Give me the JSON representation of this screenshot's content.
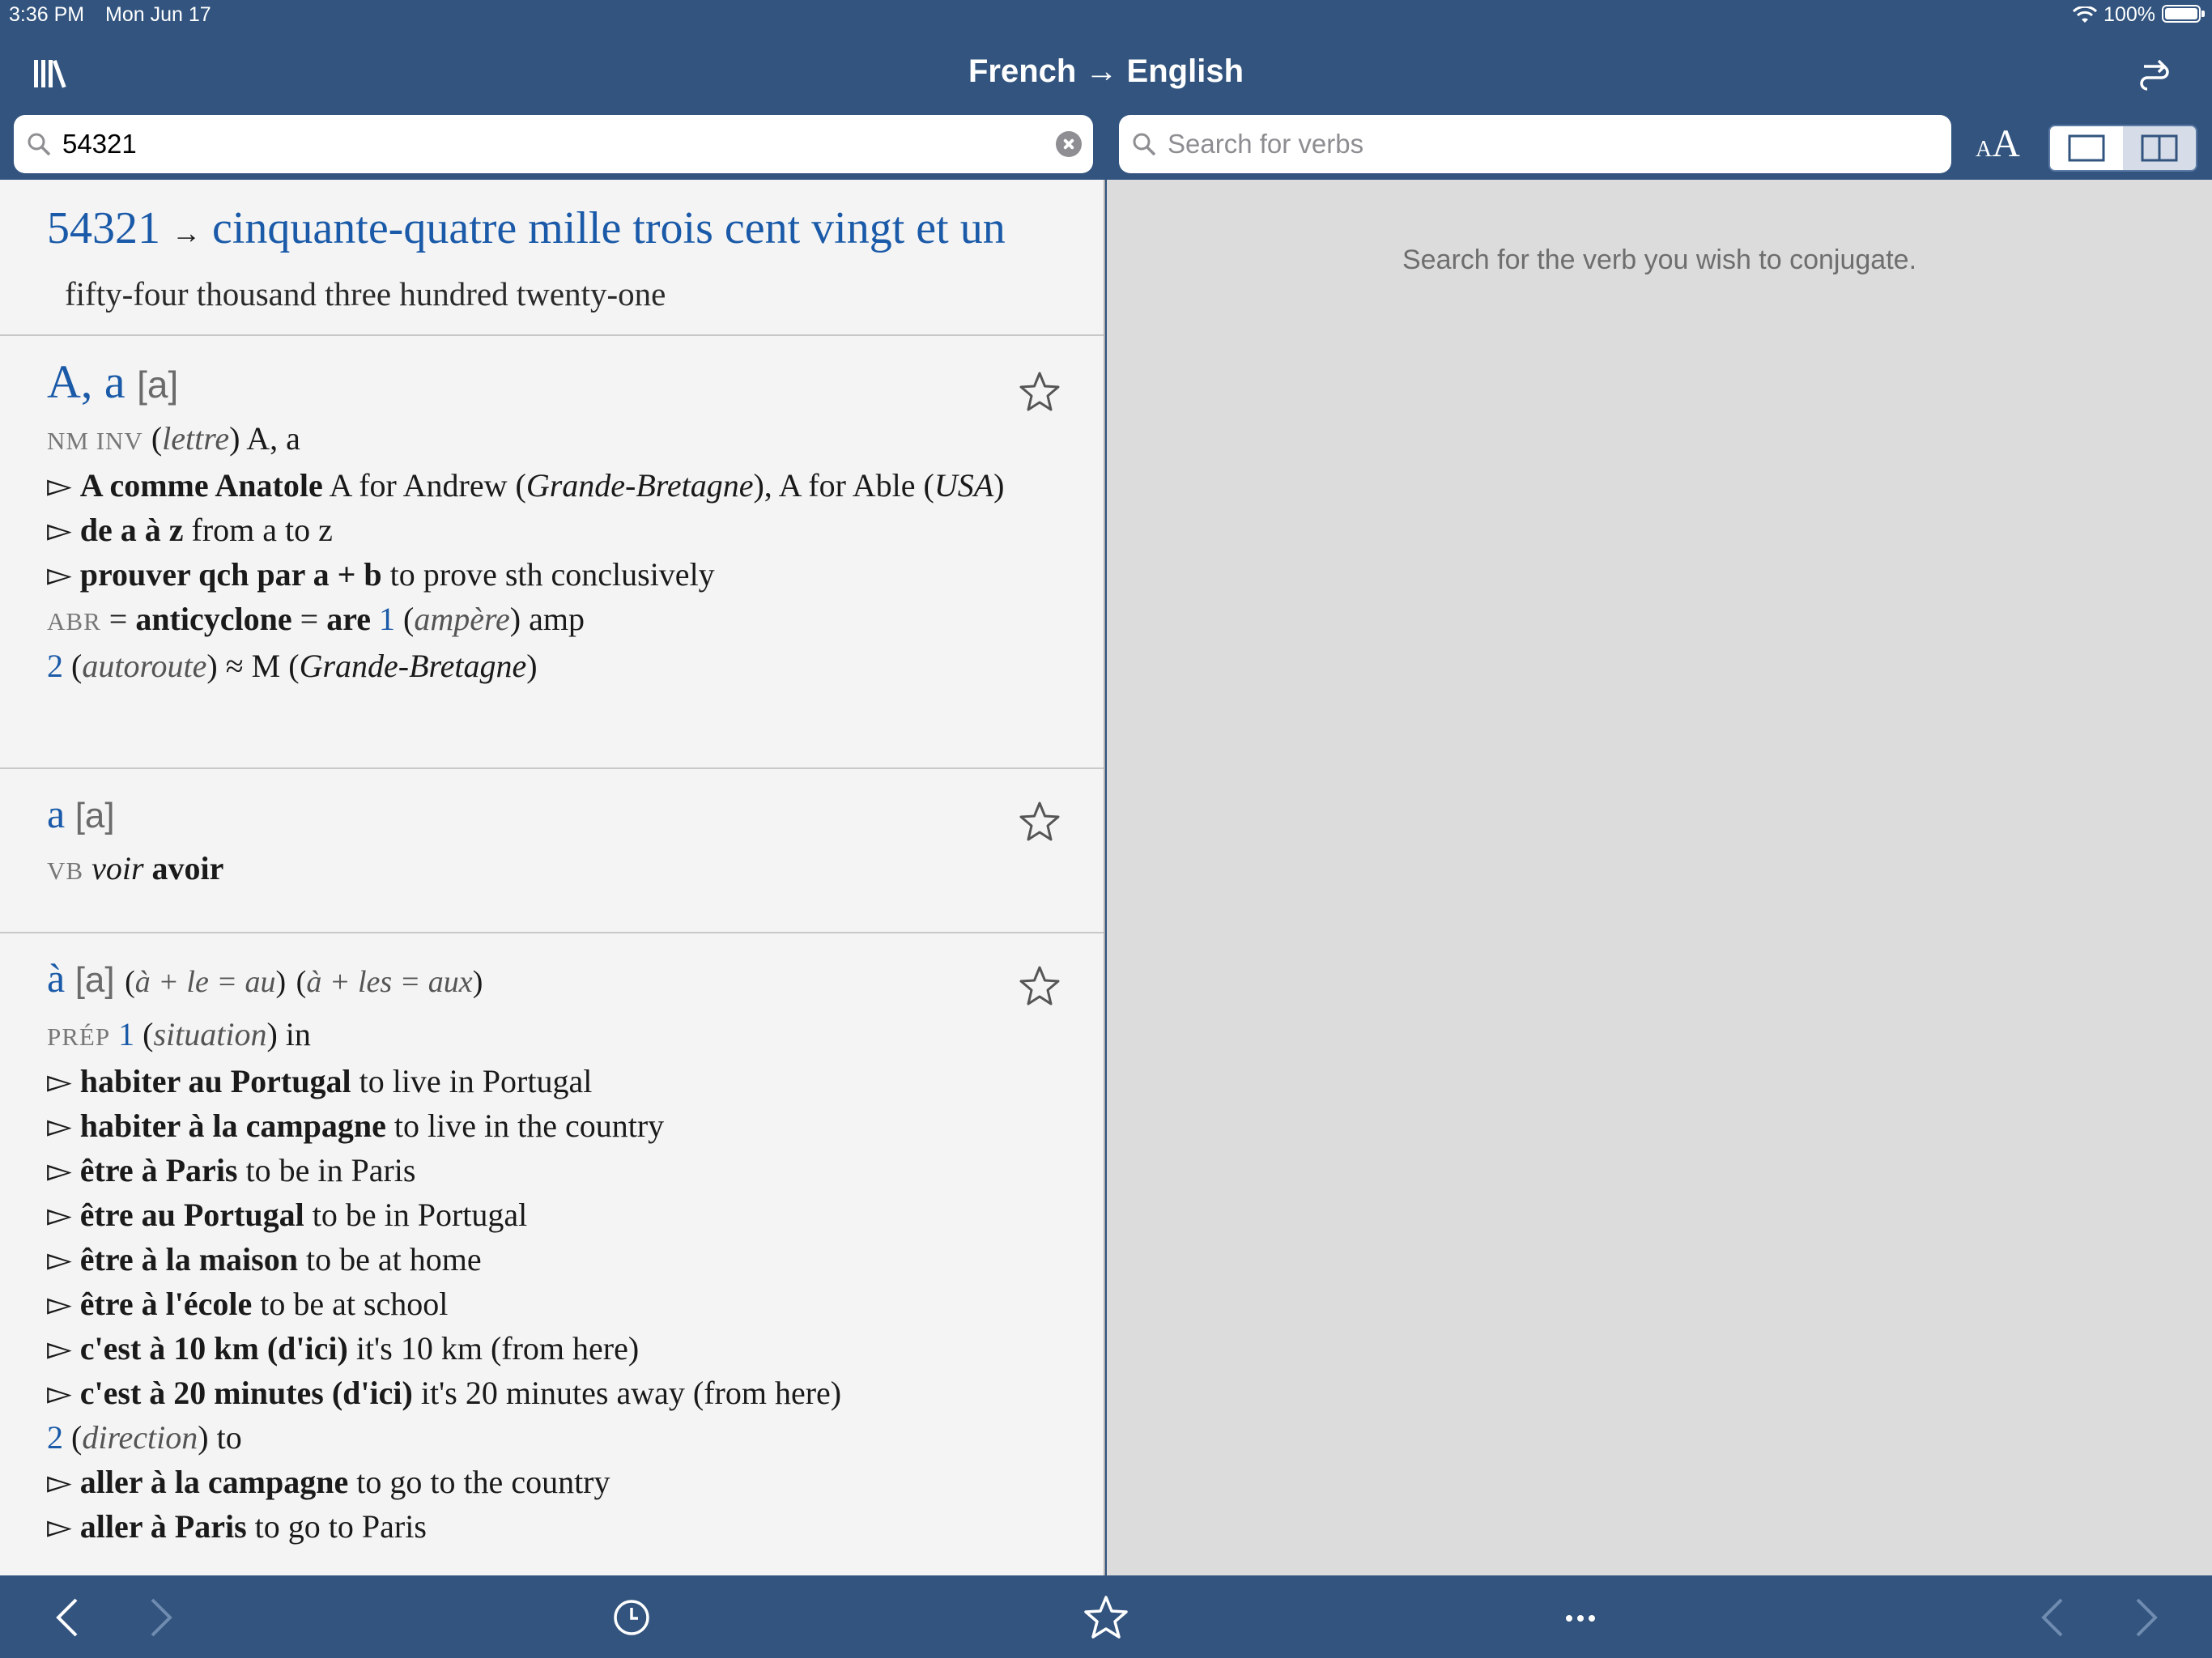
{
  "status": {
    "time": "3:36 PM",
    "date": "Mon Jun 17",
    "battery": "100%"
  },
  "nav": {
    "title": "French → English",
    "library_icon": "library-icon",
    "swap_icon": "swap-direction-icon"
  },
  "search": {
    "value": "54321",
    "verb_placeholder": "Search for verbs"
  },
  "font_size": {
    "small": "A",
    "big": "A"
  },
  "entries": {
    "number": {
      "headword": "54321",
      "arrow": "→",
      "french": "cinquante-quatre mille trois cent vingt et un",
      "translation": "fifty-four thousand three hundred twenty-one"
    },
    "A": {
      "headword": "A, a",
      "pron": "[a]",
      "line1_pos": "NM INV",
      "line1_gloss": "lettre",
      "line1_trans": "A, a",
      "ex1_fr": "A comme Anatole",
      "ex1_en_a": "A for Andrew",
      "ex1_it_a": "Grande-Bretagne",
      "ex1_en_b": "A for Able",
      "ex1_it_b": "USA",
      "ex2_fr": "de a à z",
      "ex2_en": "from a to z",
      "ex3_fr": "prouver qch par a + b",
      "ex3_en": "to prove sth conclusively",
      "abr_pos": "ABR",
      "abr_word1": "anticyclone",
      "abr_word2": "are",
      "abr_num": "1",
      "abr_gloss": "ampère",
      "abr_trans": "amp",
      "s2_num": "2",
      "s2_gloss": "autoroute",
      "s2_trans": "≈ M",
      "s2_it": "Grande-Bretagne"
    },
    "a": {
      "headword": "a",
      "pron": "[a]",
      "pos": "VB",
      "voir": "voir",
      "ref": "avoir"
    },
    "aa": {
      "headword": "à",
      "pron": "[a]",
      "contraction1": "à + le = au",
      "contraction2": "à + les = aux",
      "pos": "PRÉP",
      "s1_num": "1",
      "s1_gloss": "situation",
      "s1_trans": "in",
      "examples": [
        {
          "fr": "habiter au Portugal",
          "en": "to live in Portugal"
        },
        {
          "fr": "habiter à la campagne",
          "en": "to live in the country"
        },
        {
          "fr": "être à Paris",
          "en": "to be in Paris"
        },
        {
          "fr": "être au Portugal",
          "en": "to be in Portugal"
        },
        {
          "fr": "être à la maison",
          "en": "to be at home"
        },
        {
          "fr": "être à l'école",
          "en": "to be at school"
        },
        {
          "fr": "c'est à 10 km (d'ici)",
          "en": "it's 10 km (from here)"
        },
        {
          "fr": "c'est à 20 minutes (d'ici)",
          "en": "it's 20 minutes away (from here)"
        }
      ],
      "s2_num": "2",
      "s2_gloss": "direction",
      "s2_trans": "to",
      "ex_last_fr": "aller à la campagne",
      "ex_last_en": "to go to the country",
      "ex_cut_fr": "aller à Paris",
      "ex_cut_en": "to go to Paris"
    }
  },
  "right": {
    "hint": "Search for the verb you wish to conjugate."
  },
  "toolbar": {
    "back_icon": "chevron-left-icon",
    "forward_icon": "chevron-right-icon",
    "history_icon": "clock-icon",
    "favorites_icon": "star-icon",
    "more_icon": "ellipsis-icon",
    "page_back_icon": "chevron-left-icon",
    "page_forward_icon": "chevron-right-icon"
  },
  "colors": {
    "chrome": "#32547e",
    "headword": "#1a5aa8",
    "left_bg": "#f4f4f4",
    "right_bg": "#dcdcdc"
  }
}
